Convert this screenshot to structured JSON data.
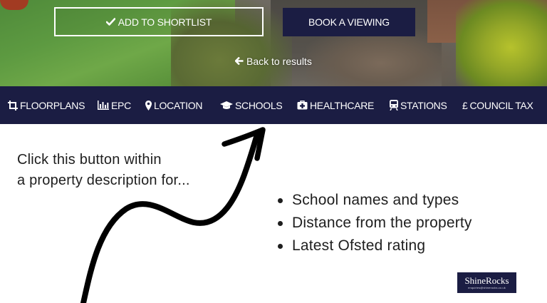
{
  "hero": {
    "shortlist_label": "ADD TO SHORTLIST",
    "viewing_label": "BOOK A VIEWING",
    "back_label": "Back to results"
  },
  "nav": {
    "items": [
      {
        "label": "FLOORPLANS",
        "icon": "crop-icon"
      },
      {
        "label": "EPC",
        "icon": "bar-chart-icon"
      },
      {
        "label": "LOCATION",
        "icon": "map-marker-icon"
      },
      {
        "label": "SCHOOLS",
        "icon": "graduation-cap-icon"
      },
      {
        "label": "HEALTHCARE",
        "icon": "medical-kit-icon"
      },
      {
        "label": "STATIONS",
        "icon": "train-icon"
      },
      {
        "label": "COUNCIL TAX",
        "icon": "pound-icon",
        "prefix": "£"
      }
    ]
  },
  "content": {
    "intro_line1": "Click this button within",
    "intro_line2": "a property description for...",
    "bullets": [
      "School names and types",
      "Distance from the property",
      "Latest Ofsted rating"
    ]
  },
  "logo": {
    "name": "ShineRocks",
    "email": "enquiries@shinerocks.co.uk"
  },
  "colors": {
    "navy": "#1b1d43",
    "text": "#1e1e1e",
    "white": "#ffffff"
  }
}
